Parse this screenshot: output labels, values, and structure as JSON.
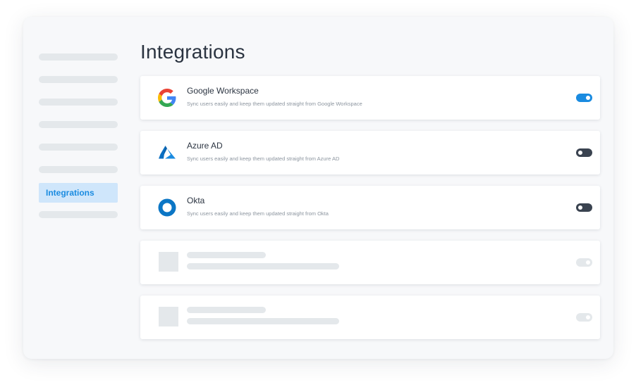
{
  "sidebar": {
    "active_item": "Integrations"
  },
  "main": {
    "title": "Integrations",
    "integrations": [
      {
        "name": "Google Workspace",
        "description": "Sync users easily and keep them updated straight from Google Workspace",
        "icon": "google-logo-icon",
        "enabled": true
      },
      {
        "name": "Azure AD",
        "description": "Sync users easily and keep them updated straight from Azure AD",
        "icon": "azure-logo-icon",
        "enabled": false
      },
      {
        "name": "Okta",
        "description": "Sync users easily and keep them updated straight from Okta",
        "icon": "okta-logo-icon",
        "enabled": false
      }
    ]
  },
  "colors": {
    "accent": "#1a8be0",
    "active_bg": "#cfe6fb",
    "toggle_off": "#3a4350",
    "placeholder": "#e4e8eb",
    "text": "#2b3441",
    "muted_text": "#8c959f"
  }
}
